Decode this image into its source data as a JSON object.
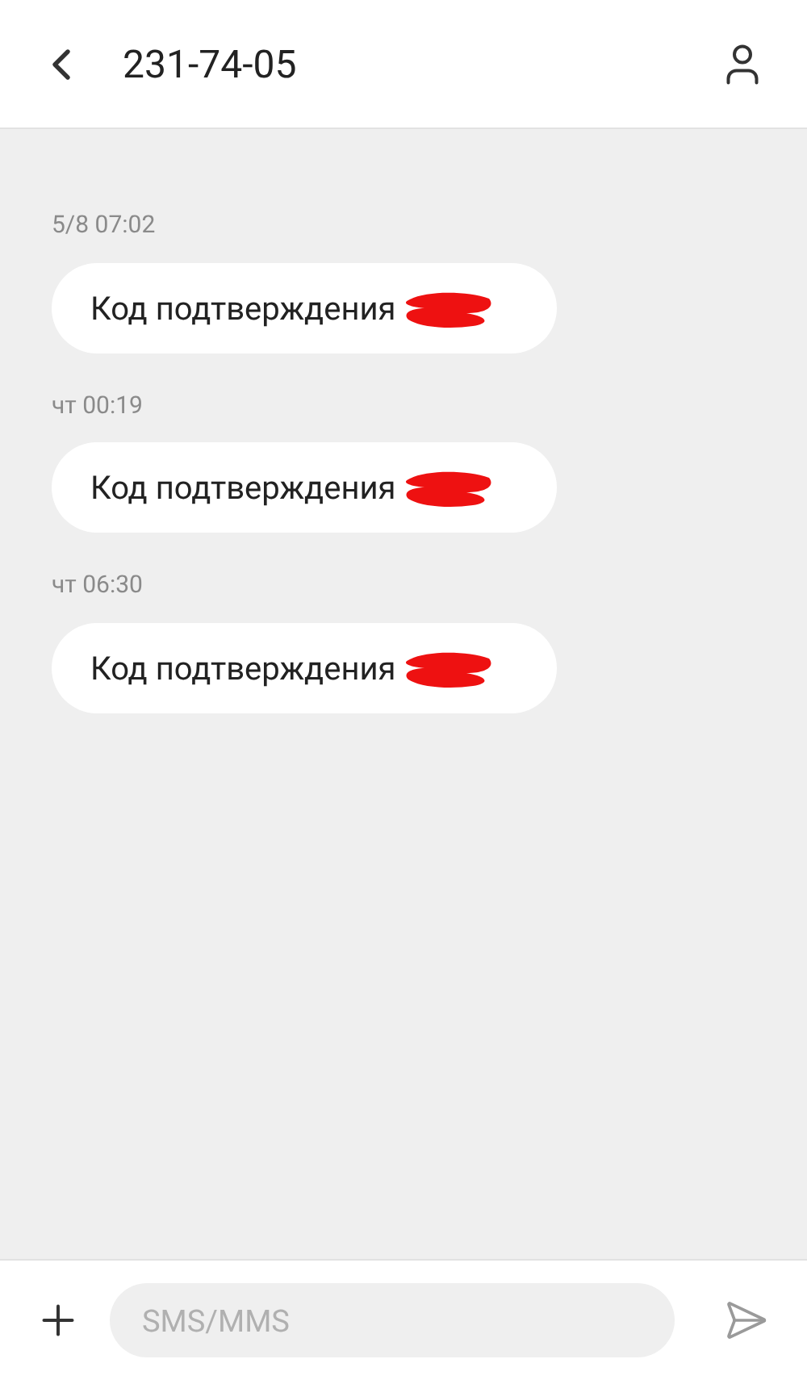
{
  "header": {
    "title": "231-74-05"
  },
  "messages": [
    {
      "time": "5/8 07:02",
      "text": "Код подтверждения",
      "redacted": true
    },
    {
      "time": "чт 00:19",
      "text": "Код подтверждения",
      "redacted": true
    },
    {
      "time": "чт 06:30",
      "text": "Код подтверждения",
      "redacted": true
    }
  ],
  "composer": {
    "placeholder": "SMS/MMS"
  }
}
